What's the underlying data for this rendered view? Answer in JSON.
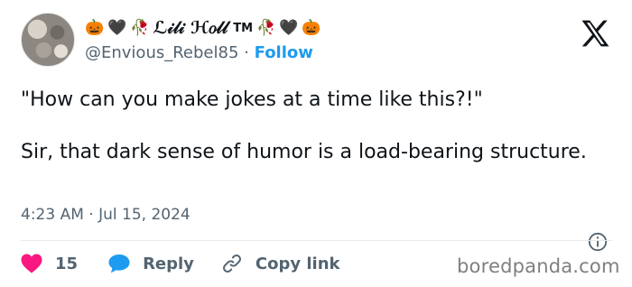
{
  "author": {
    "display_name_text": "ℒ𝒾𝓁𝒾 ℋ𝑜𝓁𝓁",
    "trademark": "TM",
    "emoji_left": [
      "🎃",
      "🖤",
      "🥀"
    ],
    "emoji_right": [
      "🥀",
      "🖤",
      "🎃"
    ],
    "handle": "@Envious_Rebel85",
    "separator": "·",
    "follow_label": "Follow"
  },
  "tweet": {
    "paragraph1": "\"How can you make jokes at a time like this?!\"",
    "paragraph2": "Sir, that dark sense of humor is a load-bearing structure."
  },
  "meta": {
    "time": "4:23 AM",
    "separator": "·",
    "date": "Jul 15, 2024"
  },
  "actions": {
    "like_count": "15",
    "reply_label": "Reply",
    "copy_link_label": "Copy link"
  },
  "watermark": "boredpanda.com",
  "icons": {
    "like": "heart-icon",
    "reply": "speech-bubble-icon",
    "copy": "link-icon",
    "info": "info-icon",
    "platform": "x-logo-icon"
  },
  "colors": {
    "like": "#f91880",
    "reply": "#1d9bf0",
    "follow": "#1d9bf0",
    "muted": "#536471"
  }
}
